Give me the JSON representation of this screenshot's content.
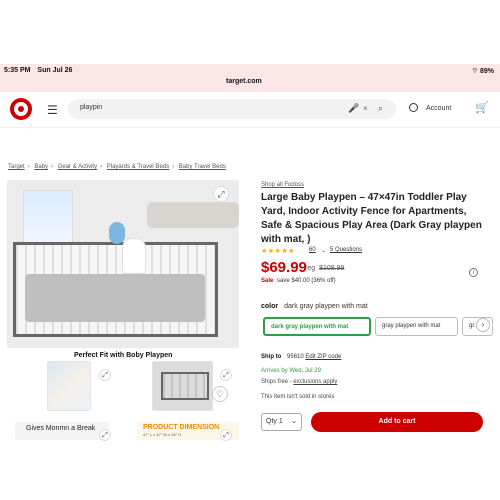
{
  "statusbar": {
    "time": "5:35 PM",
    "date": "Sun Jul 26",
    "battery": "89%"
  },
  "browser": {
    "url": "target.com"
  },
  "header": {
    "search_value": "playpin",
    "account_label": "Account"
  },
  "breadcrumbs": [
    "Target",
    "Baby",
    "Gear & Activity",
    "Playards & Travel Beds",
    "Baby Travel Beds"
  ],
  "gallery": {
    "caption": "Perfect Fit with Boby Playpen",
    "tile_left_text": "Gives Monmn a Break",
    "tile_right_title": "PRODUCT DIMENSION",
    "tile_right_sub": "47\" L x 47\" W x 26\" H"
  },
  "product": {
    "shop_all": "Shop all Fodoss",
    "title": "Large Baby Playpen – 47×47in Toddler Play Yard, Indoor Activity Fence for Apartments, Safe & Spacious Play Area (Dark Gray playpen with mat, )",
    "stars": "★★★★★",
    "rating_count": "60",
    "questions": "5 Questions",
    "price": "$69.99",
    "reg_label": "reg",
    "reg_price": "$109.99",
    "sale_label": "Sale",
    "save_text": "save $40.00 (36% off)",
    "color_label": "color",
    "color_value": "dark gray playpen with mat",
    "options": [
      "dark gray playpen with mat",
      "gray playpen with mat",
      "gr..."
    ],
    "ship_to_label": "Ship to",
    "ship_to_zip": "95610",
    "edit_zip": "Edit ZIP code",
    "arrives": "Arrives by Wed, Jul 29",
    "ships_free": "Ships free",
    "exclusions": "exclusions apply",
    "not_sold": "This item isn't sold in stores",
    "qty_label": "Qty",
    "qty_value": "1",
    "add_to_cart": "Add to cart"
  }
}
